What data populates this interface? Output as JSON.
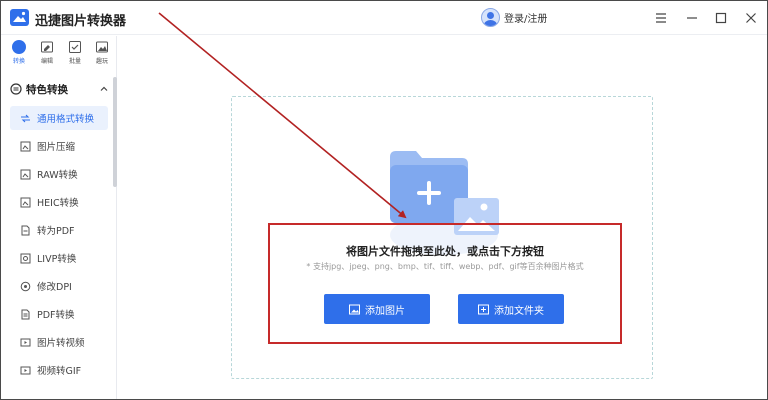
{
  "app": {
    "title": "迅捷图片转换器"
  },
  "header": {
    "user_label": "登录/注册"
  },
  "modules": [
    {
      "label": "转换",
      "icon": "convert-icon",
      "active": true
    },
    {
      "label": "编辑",
      "icon": "edit-icon",
      "active": false
    },
    {
      "label": "批量",
      "icon": "batch-icon",
      "active": false
    },
    {
      "label": "趣玩",
      "icon": "fun-icon",
      "active": false
    }
  ],
  "sidebar": {
    "section_label": "特色转换",
    "items": [
      {
        "label": "通用格式转换",
        "icon": "format-convert-icon",
        "active": true
      },
      {
        "label": "图片压缩",
        "icon": "compress-icon"
      },
      {
        "label": "RAW转换",
        "icon": "raw-icon"
      },
      {
        "label": "HEIC转换",
        "icon": "heic-icon"
      },
      {
        "label": "转为PDF",
        "icon": "pdf-icon"
      },
      {
        "label": "LIVP转换",
        "icon": "livp-icon"
      },
      {
        "label": "修改DPI",
        "icon": "dpi-icon"
      },
      {
        "label": "PDF转换",
        "icon": "pdf-convert-icon"
      },
      {
        "label": "图片转视频",
        "icon": "image-to-video-icon"
      },
      {
        "label": "视频转GIF",
        "icon": "video-to-gif-icon"
      }
    ]
  },
  "dropzone": {
    "title": "将图片文件拖拽至此处，或点击下方按钮",
    "subtitle": "* 支持jpg、jpeg、png、bmp、tif、tiff、webp、pdf、gif等百余种图片格式",
    "add_image_label": "添加图片",
    "add_folder_label": "添加文件夹"
  },
  "colors": {
    "accent": "#2f6fea",
    "annotation": "#c62a2a"
  }
}
